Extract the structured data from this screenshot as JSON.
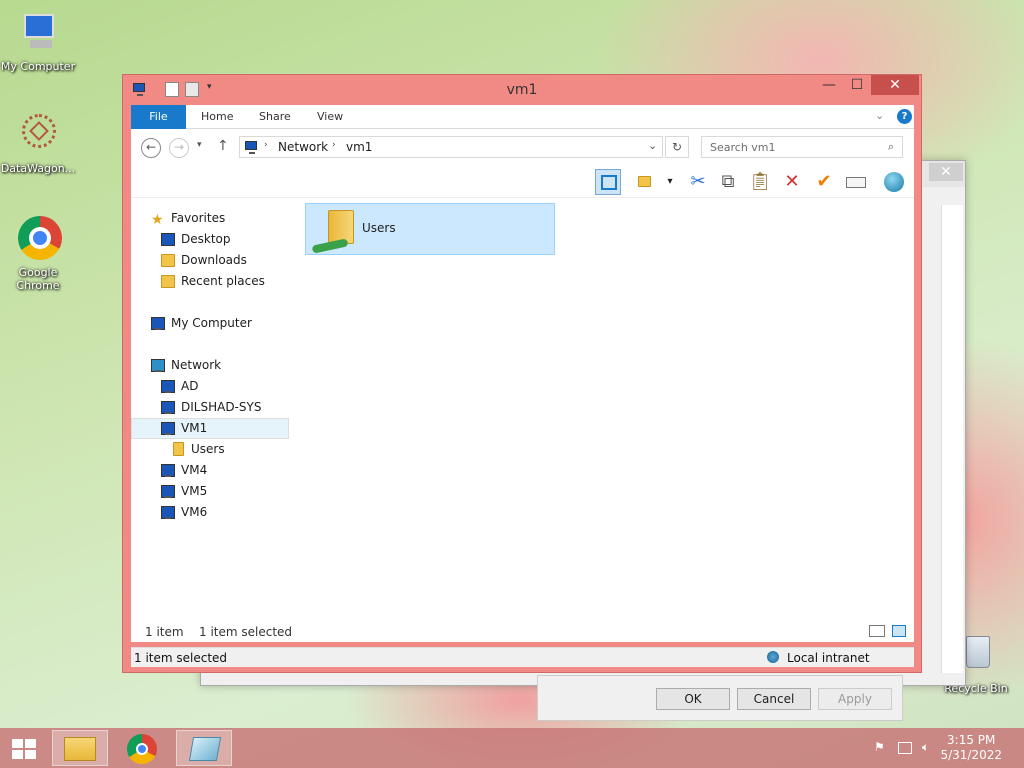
{
  "desktop": {
    "icons": [
      {
        "label": "My Computer"
      },
      {
        "label": "DataWagon..."
      },
      {
        "label": "Google Chrome"
      },
      {
        "label": "Recycle Bin"
      }
    ]
  },
  "background_dialog": {
    "ok": "OK",
    "cancel": "Cancel",
    "apply": "Apply",
    "close": "✕"
  },
  "window": {
    "title": "vm1",
    "controls": {
      "minimize": "—",
      "maximize": "☐",
      "close": "✕"
    },
    "ribbon_tabs": [
      "File",
      "Home",
      "Share",
      "View"
    ],
    "address": {
      "segments": [
        "Network",
        "vm1"
      ]
    },
    "search_placeholder": "Search vm1",
    "nav_pane": {
      "favorites": {
        "label": "Favorites",
        "items": [
          "Desktop",
          "Downloads",
          "Recent places"
        ]
      },
      "my_computer": "My Computer",
      "network": {
        "label": "Network",
        "items": [
          "AD",
          "DILSHAD-SYS",
          "VM1",
          "VM4",
          "VM5",
          "VM6"
        ]
      },
      "vm1_children": [
        "Users"
      ],
      "selected": "VM1"
    },
    "content": {
      "items": [
        {
          "name": "Users",
          "selected": true
        }
      ]
    },
    "status": {
      "count": "1 item",
      "selection": "1 item selected"
    },
    "statusbar": {
      "left": "1 item selected",
      "zone": "Local intranet"
    }
  },
  "taskbar": {
    "time": "3:15 PM",
    "date": "5/31/2022"
  },
  "colors": {
    "accent": "#1979ca",
    "window_frame": "#f18a85",
    "selection": "#cce8ff"
  }
}
